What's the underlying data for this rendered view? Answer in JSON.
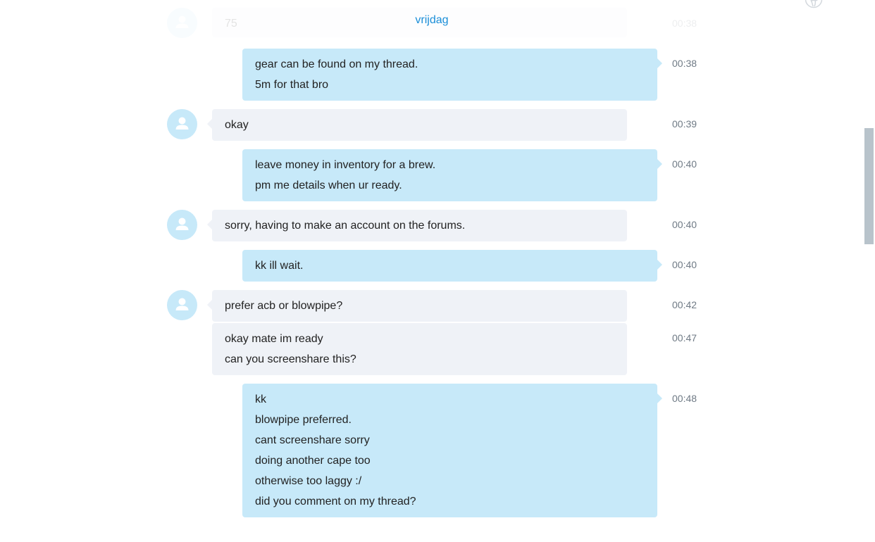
{
  "day_separator": "vrijdag",
  "faded_message": {
    "text": "75",
    "time": "00:38"
  },
  "messages": [
    {
      "id": 1,
      "direction": "outgoing",
      "lines": [
        "gear can be found on my thread.",
        "5m for that bro"
      ],
      "time": "00:38"
    },
    {
      "id": 2,
      "direction": "incoming",
      "lines": [
        "okay"
      ],
      "time": "00:39"
    },
    {
      "id": 3,
      "direction": "outgoing",
      "lines": [
        "leave money in inventory for a brew.",
        "pm me details when ur ready."
      ],
      "time": "00:40"
    },
    {
      "id": 4,
      "direction": "incoming",
      "lines": [
        "sorry, having to make an account on the forums."
      ],
      "time": "00:40"
    },
    {
      "id": 5,
      "direction": "outgoing",
      "lines": [
        "kk ill wait."
      ],
      "time": "00:40"
    },
    {
      "id": 6,
      "direction": "incoming",
      "lines": [
        "prefer acb or blowpipe?"
      ],
      "time": "00:42"
    },
    {
      "id": 7,
      "direction": "incoming",
      "lines": [
        "okay mate im ready",
        "can you screenshare this?"
      ],
      "time": "00:47"
    },
    {
      "id": 8,
      "direction": "outgoing",
      "lines": [
        "kk",
        "blowpipe preferred.",
        "cant screenshare sorry",
        "doing another cape too",
        "otherwise too laggy :/",
        "did you comment on my thread?"
      ],
      "time": "00:48"
    }
  ],
  "colors": {
    "incoming_bubble": "#eff2f7",
    "outgoing_bubble": "#c7e9f9",
    "day_separator": "#1a8ed8",
    "timestamp": "#6f7a85",
    "avatar": "#c7e9f9"
  },
  "icons": {
    "avatar": "person-icon",
    "top_right": "globe-icon"
  }
}
